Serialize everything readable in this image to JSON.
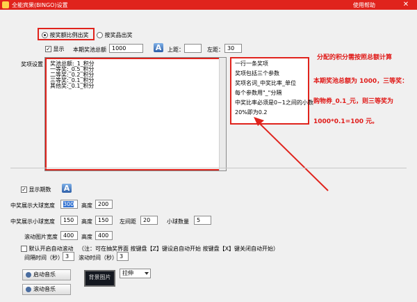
{
  "window": {
    "title": "全能宾果(BINGO)设置",
    "help": "使用帮助",
    "close": "✕"
  },
  "mode": {
    "option1": "按奖额比例出奖",
    "option2": "按奖品出奖"
  },
  "display": {
    "show_label": "显示",
    "pool_label": "本期奖池总额",
    "pool_value": "1000",
    "top_label": "上距：",
    "top_value": "",
    "left_label": "左距：",
    "left_value": "30"
  },
  "prize_settings": {
    "label": "奖项设置",
    "lines": [
      "奖池总额:_1_积分",
      "一等奖:_0.5_积分",
      "二等奖:_0.2_积分",
      "三等奖:_0.1_积分",
      "其他奖:_0.1_积分"
    ]
  },
  "hints": [
    "一行一条奖项",
    "奖项包括三个参数",
    "奖项名词_中奖比率_单位",
    "每个参数用\"_\"分隔",
    "中奖比率必须是0~1之间的小数",
    "20%即为0.2"
  ],
  "annotation": {
    "line1": "分配的积分需按照总额计算",
    "line2": "本期奖池总额为 1000，三等奖：",
    "line3": "购物券_0.1_元，则三等奖为",
    "line4": "1000*0.1=100 元。"
  },
  "period": {
    "show_label": "显示期数"
  },
  "ball_size": {
    "big_width_label": "中奖展示大球宽度",
    "big_width": "300",
    "height_label": "高度",
    "big_height": "200",
    "small_width_label": "中奖展示小球宽度",
    "small_width": "150",
    "small_height": "150",
    "left_gap_label": "左间距",
    "left_gap": "20",
    "small_count_label": "小球数量",
    "small_count": "5",
    "scroll_width_label": "滚动图片宽度",
    "scroll_width": "400",
    "scroll_height": "400"
  },
  "auto": {
    "label": "默认开启自动滚动",
    "note": "（注：可在抽奖界面 按键盘【Z】键设启自动开始 按键盘【X】键关闭自动开始）",
    "interval_label": "间隔时间（秒）",
    "interval": "3",
    "scroll_time_label": "滚动时间（秒）",
    "scroll_time": "3"
  },
  "music": {
    "start": "启动音乐",
    "scroll": "滚动音乐"
  },
  "background": {
    "label": "背景图片",
    "stretch": "拉伸"
  },
  "colors": {
    "accent": "#e0231c"
  }
}
